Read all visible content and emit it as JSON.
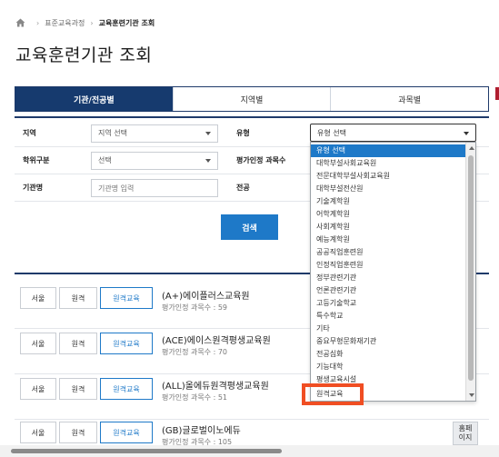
{
  "breadcrumb": {
    "home_icon": "home-icon",
    "level1": "표준교육과정",
    "level2": "교육훈련기관 조회"
  },
  "page_title": "교육훈련기관 조회",
  "tabs": [
    {
      "label": "기관/전공별",
      "active": true
    },
    {
      "label": "지역별",
      "active": false
    },
    {
      "label": "과목별",
      "active": false
    }
  ],
  "filters": {
    "region_label": "지역",
    "region_value": "지역 선택",
    "type_label": "유형",
    "type_value": "유형 선택",
    "degree_label": "학위구분",
    "degree_value": "선택",
    "accredited_label": "평가인정 과목수",
    "org_label": "기관명",
    "org_placeholder": "기관명 입력",
    "major_label": "전공"
  },
  "search_label": "검색",
  "type_dropdown": {
    "options": [
      {
        "label": "유형 선택",
        "selected": true
      },
      {
        "label": "대학부설사회교육원"
      },
      {
        "label": "전문대학부설사회교육원"
      },
      {
        "label": "대학부설전산원"
      },
      {
        "label": "기술계학원"
      },
      {
        "label": "어학계학원"
      },
      {
        "label": "사회계학원"
      },
      {
        "label": "예능계학원"
      },
      {
        "label": "공공직업훈련원"
      },
      {
        "label": "인정직업훈련원"
      },
      {
        "label": "정부관련기관"
      },
      {
        "label": "언론관련기관"
      },
      {
        "label": "고등기술학교"
      },
      {
        "label": "특수학교"
      },
      {
        "label": "기타"
      },
      {
        "label": "중요무형문화재기관"
      },
      {
        "label": "전공심화"
      },
      {
        "label": "기능대학"
      },
      {
        "label": "평생교육시설"
      },
      {
        "label": "원격교육",
        "highlighted": true
      }
    ]
  },
  "institutions": [
    {
      "region": "서울",
      "mode": "원격",
      "category": "원격교육",
      "name": "(A+)에이플러스교육원",
      "count": "평가인정 과목수 : 59"
    },
    {
      "region": "서울",
      "mode": "원격",
      "category": "원격교육",
      "name": "(ACE)에이스원격평생교육원",
      "count": "평가인정 과목수 : 70"
    },
    {
      "region": "서울",
      "mode": "원격",
      "category": "원격교육",
      "name": "(ALL)올에듀원격평생교육원",
      "count": "평가인정 과목수 : 51"
    },
    {
      "region": "서울",
      "mode": "원격",
      "category": "원격교육",
      "name": "(GB)글로벌이노에듀",
      "count": "평가인정 과목수 : 105",
      "side_button": "홈페\n이지"
    }
  ],
  "colors": {
    "navy": "#163a6e",
    "accent": "#1e79c8",
    "highlight": "#f04e23"
  }
}
